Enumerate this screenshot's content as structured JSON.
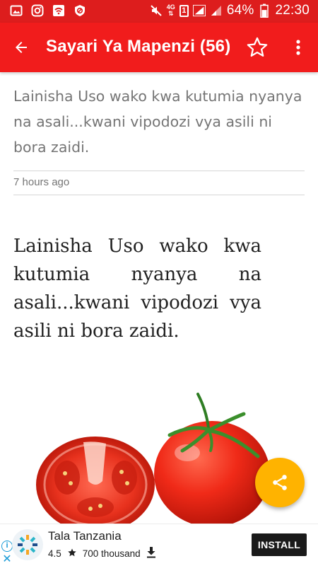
{
  "status_bar": {
    "battery_percent": "64%",
    "time": "22:30",
    "network_type": "4G",
    "sim_slot": "1",
    "battery_level": 0.64,
    "left_icons": [
      "image-icon",
      "instagram-icon",
      "wifi-calling-icon",
      "vpn-shield-icon"
    ],
    "right_icons": [
      "mute-icon",
      "network-4g-icon",
      "sim-1-icon",
      "signal-icon",
      "signal-icon",
      "battery-icon"
    ]
  },
  "app_bar": {
    "title": "Sayari Ya Mapenzi (56)",
    "background": "#f11c1c"
  },
  "article": {
    "summary": "Lainisha Uso wako kwa kutumia nyanya na asali...kwani vipodozi vya asili ni bora zaidi.",
    "timestamp": "7 hours ago",
    "body": "Lainisha Uso wako kwa kutumia nyanya na asali...kwani vipodozi vya asili ni bora zaidi."
  },
  "fab": {
    "icon": "share-icon",
    "color": "#ffb300"
  },
  "ad": {
    "app_name": "Tala Tanzania",
    "rating": "4.5",
    "downloads": "700 thousand",
    "install_label": "INSTALL"
  },
  "colors": {
    "status_bar": "#dd1d1d",
    "accent": "#f11c1c",
    "fab": "#ffb300",
    "ad_info": "#1a9bd7"
  }
}
